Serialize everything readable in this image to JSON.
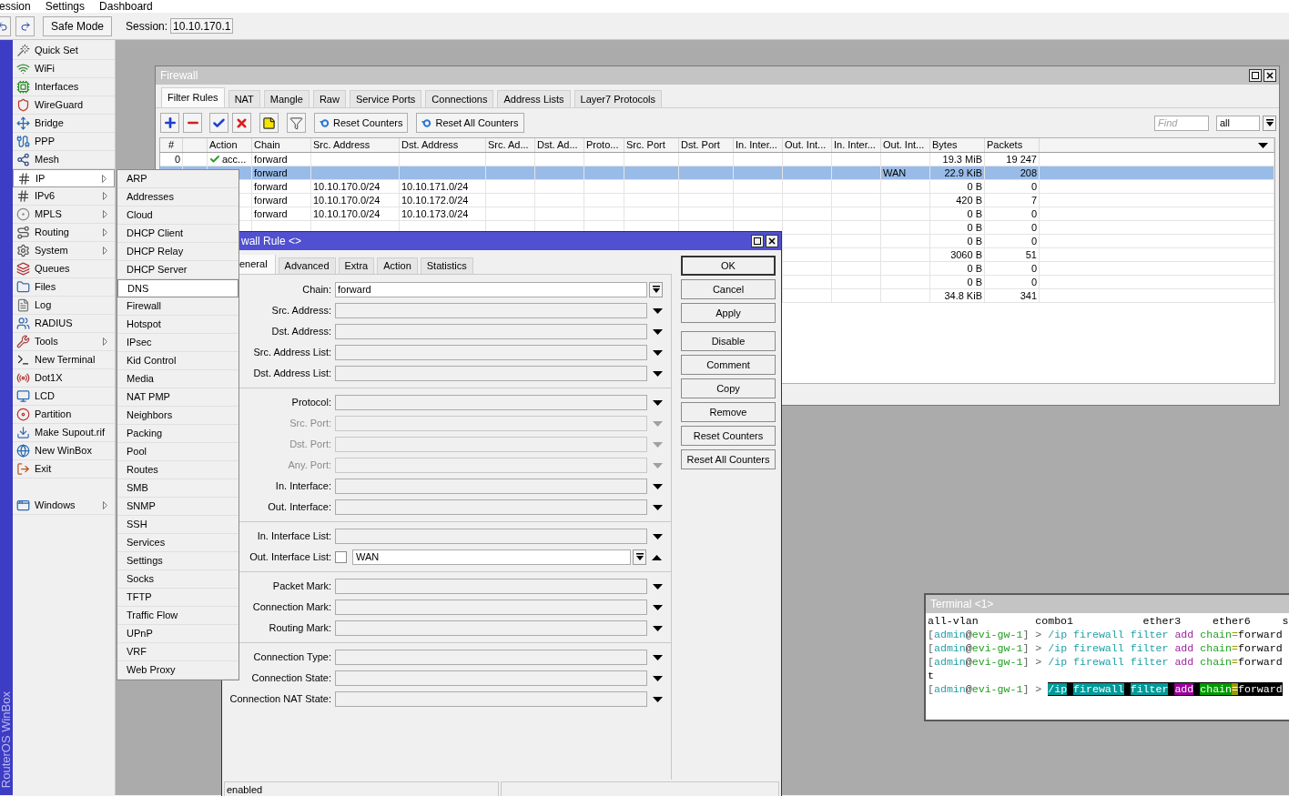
{
  "menu_bar": [
    "ession",
    "Settings",
    "Dashboard"
  ],
  "toolbar": {
    "safe_mode": "Safe Mode",
    "session_label": "Session:",
    "session_value": "10.10.170.1"
  },
  "brand": "RouterOS WinBox",
  "sidebar": {
    "items": [
      {
        "label": "Quick Set",
        "has_submenu": false,
        "selected": false
      },
      {
        "label": "WiFi",
        "has_submenu": false,
        "selected": false
      },
      {
        "label": "Interfaces",
        "has_submenu": false,
        "selected": false
      },
      {
        "label": "WireGuard",
        "has_submenu": false,
        "selected": false
      },
      {
        "label": "Bridge",
        "has_submenu": false,
        "selected": false
      },
      {
        "label": "PPP",
        "has_submenu": false,
        "selected": false
      },
      {
        "label": "Mesh",
        "has_submenu": false,
        "selected": false
      },
      {
        "label": "IP",
        "has_submenu": true,
        "selected": true
      },
      {
        "label": "IPv6",
        "has_submenu": true,
        "selected": false
      },
      {
        "label": "MPLS",
        "has_submenu": true,
        "selected": false
      },
      {
        "label": "Routing",
        "has_submenu": true,
        "selected": false
      },
      {
        "label": "System",
        "has_submenu": true,
        "selected": false
      },
      {
        "label": "Queues",
        "has_submenu": false,
        "selected": false
      },
      {
        "label": "Files",
        "has_submenu": false,
        "selected": false
      },
      {
        "label": "Log",
        "has_submenu": false,
        "selected": false
      },
      {
        "label": "RADIUS",
        "has_submenu": false,
        "selected": false
      },
      {
        "label": "Tools",
        "has_submenu": true,
        "selected": false
      },
      {
        "label": "New Terminal",
        "has_submenu": false,
        "selected": false
      },
      {
        "label": "Dot1X",
        "has_submenu": false,
        "selected": false
      },
      {
        "label": "LCD",
        "has_submenu": false,
        "selected": false
      },
      {
        "label": "Partition",
        "has_submenu": false,
        "selected": false
      },
      {
        "label": "Make Supout.rif",
        "has_submenu": false,
        "selected": false
      },
      {
        "label": "New WinBox",
        "has_submenu": false,
        "selected": false
      },
      {
        "label": "Exit",
        "has_submenu": false,
        "selected": false
      }
    ],
    "bottom_items": [
      {
        "label": "Windows",
        "has_submenu": true,
        "selected": false
      }
    ]
  },
  "submenu": {
    "items": [
      {
        "label": "ARP",
        "selected": false
      },
      {
        "label": "Addresses",
        "selected": false
      },
      {
        "label": "Cloud",
        "selected": false
      },
      {
        "label": "DHCP Client",
        "selected": false
      },
      {
        "label": "DHCP Relay",
        "selected": false
      },
      {
        "label": "DHCP Server",
        "selected": false
      },
      {
        "label": "DNS",
        "selected": true
      },
      {
        "label": "Firewall",
        "selected": false
      },
      {
        "label": "Hotspot",
        "selected": false
      },
      {
        "label": "IPsec",
        "selected": false
      },
      {
        "label": "Kid Control",
        "selected": false
      },
      {
        "label": "Media",
        "selected": false
      },
      {
        "label": "NAT PMP",
        "selected": false
      },
      {
        "label": "Neighbors",
        "selected": false
      },
      {
        "label": "Packing",
        "selected": false
      },
      {
        "label": "Pool",
        "selected": false
      },
      {
        "label": "Routes",
        "selected": false
      },
      {
        "label": "SMB",
        "selected": false
      },
      {
        "label": "SNMP",
        "selected": false
      },
      {
        "label": "SSH",
        "selected": false
      },
      {
        "label": "Services",
        "selected": false
      },
      {
        "label": "Settings",
        "selected": false
      },
      {
        "label": "Socks",
        "selected": false
      },
      {
        "label": "TFTP",
        "selected": false
      },
      {
        "label": "Traffic Flow",
        "selected": false
      },
      {
        "label": "UPnP",
        "selected": false
      },
      {
        "label": "VRF",
        "selected": false
      },
      {
        "label": "Web Proxy",
        "selected": false
      }
    ]
  },
  "firewall": {
    "title": "Firewall",
    "tabs": [
      {
        "label": "Filter Rules",
        "selected": true
      },
      {
        "label": "NAT",
        "selected": false
      },
      {
        "label": "Mangle",
        "selected": false
      },
      {
        "label": "Raw",
        "selected": false
      },
      {
        "label": "Service Ports",
        "selected": false
      },
      {
        "label": "Connections",
        "selected": false
      },
      {
        "label": "Address Lists",
        "selected": false
      },
      {
        "label": "Layer7 Protocols",
        "selected": false
      }
    ],
    "toolbar_buttons": [
      "Reset Counters",
      "Reset All Counters"
    ],
    "find": {
      "placeholder": "Find"
    },
    "filter": {
      "value": "all"
    },
    "columns": [
      "#",
      "Action",
      "Chain",
      "Src. Address",
      "Dst. Address",
      "Src. Ad...",
      "Dst. Ad...",
      "Proto...",
      "Src. Port",
      "Dst. Port",
      "In. Inter...",
      "Out. Int...",
      "In. Inter...",
      "Out. Int...",
      "Bytes",
      "Packets"
    ],
    "rows": [
      {
        "selected": false,
        "number": "0",
        "action": "acc...",
        "chain": "forward",
        "bytes": "19.3 MiB",
        "packets": "19 247"
      },
      {
        "selected": true,
        "chain": "forward",
        "out_int": "WAN",
        "bytes": "22.9 KiB",
        "packets": "208"
      },
      {
        "selected": false,
        "chain": "forward",
        "src_address": "10.10.170.0/24",
        "dst_address": "10.10.171.0/24",
        "bytes": "0 B",
        "packets": "0"
      },
      {
        "selected": false,
        "chain": "forward",
        "src_address": "10.10.170.0/24",
        "dst_address": "10.10.172.0/24",
        "bytes": "420 B",
        "packets": "7"
      },
      {
        "selected": false,
        "chain": "forward",
        "src_address": "10.10.170.0/24",
        "dst_address": "10.10.173.0/24",
        "bytes": "0 B",
        "packets": "0"
      },
      {
        "selected": false,
        "bytes": "0 B",
        "packets": "0"
      },
      {
        "selected": false,
        "bytes": "0 B",
        "packets": "0"
      },
      {
        "selected": false,
        "bytes": "3060 B",
        "packets": "51"
      },
      {
        "selected": false,
        "bytes": "0 B",
        "packets": "0"
      },
      {
        "selected": false,
        "bytes": "0 B",
        "packets": "0"
      },
      {
        "selected": false,
        "bytes": "34.8 KiB",
        "packets": "341"
      }
    ]
  },
  "rule_dialog": {
    "title": "wall Rule <>",
    "tabs": [
      {
        "label": "eneral",
        "selected": true
      },
      {
        "label": "Advanced",
        "selected": false
      },
      {
        "label": "Extra",
        "selected": false
      },
      {
        "label": "Action",
        "selected": false
      },
      {
        "label": "Statistics",
        "selected": false
      }
    ],
    "groups": [
      {
        "fields": [
          {
            "label": "Chain:",
            "kind": "combo",
            "disabled": false,
            "value": "forward"
          },
          {
            "label": "Src. Address:",
            "kind": "dropdown",
            "disabled": false
          },
          {
            "label": "Dst. Address:",
            "kind": "dropdown",
            "disabled": false
          },
          {
            "label": "Src. Address List:",
            "kind": "dropdown",
            "disabled": false
          },
          {
            "label": "Dst. Address List:",
            "kind": "dropdown",
            "disabled": false
          }
        ]
      },
      {
        "fields": [
          {
            "label": "Protocol:",
            "kind": "dropdown",
            "disabled": false
          },
          {
            "label": "Src. Port:",
            "kind": "dropdown",
            "disabled": true
          },
          {
            "label": "Dst. Port:",
            "kind": "dropdown",
            "disabled": true
          },
          {
            "label": "Any. Port:",
            "kind": "dropdown",
            "disabled": true
          },
          {
            "label": "In. Interface:",
            "kind": "dropdown",
            "disabled": false
          },
          {
            "label": "Out. Interface:",
            "kind": "dropdown",
            "disabled": false
          }
        ]
      },
      {
        "fields": [
          {
            "label": "In. Interface List:",
            "kind": "dropdown",
            "disabled": false
          },
          {
            "label": "Out. Interface List:",
            "kind": "checkbox_combo",
            "disabled": false,
            "checked": false,
            "value": "WAN"
          }
        ]
      },
      {
        "fields": [
          {
            "label": "Packet Mark:",
            "kind": "dropdown",
            "disabled": false
          },
          {
            "label": "Connection Mark:",
            "kind": "dropdown",
            "disabled": false
          },
          {
            "label": "Routing Mark:",
            "kind": "dropdown",
            "disabled": false
          }
        ]
      },
      {
        "fields": [
          {
            "label": "Connection Type:",
            "kind": "dropdown",
            "disabled": false
          },
          {
            "label": "Connection State:",
            "kind": "dropdown",
            "disabled": false
          },
          {
            "label": "Connection NAT State:",
            "kind": "dropdown",
            "disabled": false
          }
        ]
      }
    ],
    "button_groups": [
      [
        {
          "label": "OK",
          "default": true
        },
        {
          "label": "Cancel",
          "default": false
        },
        {
          "label": "Apply",
          "default": false
        }
      ],
      [
        {
          "label": "Disable",
          "default": false
        },
        {
          "label": "Comment",
          "default": false
        },
        {
          "label": "Copy",
          "default": false
        },
        {
          "label": "Remove",
          "default": false
        },
        {
          "label": "Reset Counters",
          "default": false
        },
        {
          "label": "Reset All Counters",
          "default": false
        }
      ]
    ],
    "status": "enabled"
  },
  "terminal": {
    "title": "Terminal <1>",
    "lines": [
      {
        "kind": "output",
        "text": "all-vlan         combo1           ether3     ether6     s"
      },
      {
        "kind": "command",
        "highlighted": false,
        "prompt": [
          {
            "kind": "bracket",
            "text": "["
          },
          {
            "kind": "user",
            "text": "admin"
          },
          {
            "kind": "at",
            "text": "@"
          },
          {
            "kind": "host",
            "text": "evi-gw-1"
          },
          {
            "kind": "bracket",
            "text": "] >"
          }
        ],
        "tokens": [
          {
            "kind": "path",
            "text": "/ip"
          },
          {
            "kind": "path",
            "text": "firewall"
          },
          {
            "kind": "path",
            "text": "filter"
          },
          {
            "kind": "verb",
            "text": "add"
          },
          {
            "kind": "param",
            "text": "chain"
          },
          {
            "kind": "operator",
            "text": "="
          },
          {
            "kind": "value",
            "text": "forward"
          }
        ]
      },
      {
        "kind": "command",
        "highlighted": false,
        "prompt": [
          {
            "kind": "bracket",
            "text": "["
          },
          {
            "kind": "user",
            "text": "admin"
          },
          {
            "kind": "at",
            "text": "@"
          },
          {
            "kind": "host",
            "text": "evi-gw-1"
          },
          {
            "kind": "bracket",
            "text": "] >"
          }
        ],
        "tokens": [
          {
            "kind": "path",
            "text": "/ip"
          },
          {
            "kind": "path",
            "text": "firewall"
          },
          {
            "kind": "path",
            "text": "filter"
          },
          {
            "kind": "verb",
            "text": "add"
          },
          {
            "kind": "param",
            "text": "chain"
          },
          {
            "kind": "operator",
            "text": "="
          },
          {
            "kind": "value",
            "text": "forward"
          }
        ]
      },
      {
        "kind": "command",
        "highlighted": false,
        "prompt": [
          {
            "kind": "bracket",
            "text": "["
          },
          {
            "kind": "user",
            "text": "admin"
          },
          {
            "kind": "at",
            "text": "@"
          },
          {
            "kind": "host",
            "text": "evi-gw-1"
          },
          {
            "kind": "bracket",
            "text": "] >"
          }
        ],
        "tokens": [
          {
            "kind": "path",
            "text": "/ip"
          },
          {
            "kind": "path",
            "text": "firewall"
          },
          {
            "kind": "path",
            "text": "filter"
          },
          {
            "kind": "verb",
            "text": "add"
          },
          {
            "kind": "param",
            "text": "chain"
          },
          {
            "kind": "operator",
            "text": "="
          },
          {
            "kind": "value",
            "text": "forward"
          }
        ]
      },
      {
        "kind": "output",
        "text": "t"
      },
      {
        "kind": "command",
        "highlighted": true,
        "prompt": [
          {
            "kind": "bracket",
            "text": "["
          },
          {
            "kind": "user",
            "text": "admin"
          },
          {
            "kind": "at",
            "text": "@"
          },
          {
            "kind": "host",
            "text": "evi-gw-1"
          },
          {
            "kind": "bracket",
            "text": "] >"
          }
        ],
        "tokens": [
          {
            "kind": "path",
            "text": "/ip"
          },
          {
            "kind": "path",
            "text": "firewall"
          },
          {
            "kind": "path",
            "text": "filter"
          },
          {
            "kind": "verb",
            "text": "add"
          },
          {
            "kind": "param",
            "text": "chain"
          },
          {
            "kind": "operator",
            "text": "="
          },
          {
            "kind": "value",
            "text": "forward"
          }
        ]
      }
    ]
  }
}
